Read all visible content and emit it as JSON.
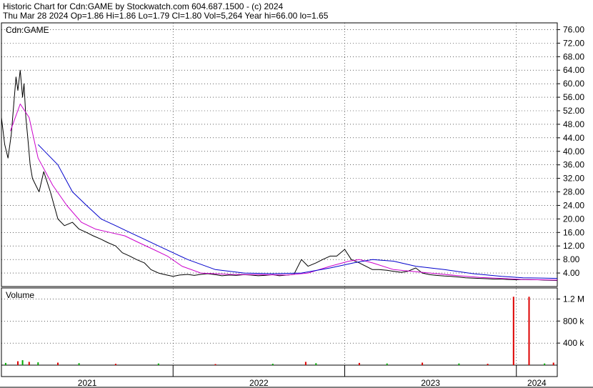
{
  "header": {
    "line1": "Historic Chart for Cdn:GAME by Stockwatch.com 604.687.1500 - (c) 2024",
    "line2": "Thu Mar 28 2024  Op=1.86  Hi=1.86  Lo=1.79  Cl=1.80  Vol=5,264  Year hi=66.00  lo=1.65"
  },
  "colors": {
    "price": "#000000",
    "ma_short": "#cc00cc",
    "ma_long": "#0000cc",
    "volume_up": "#00aa00",
    "volume_down": "#dd0000",
    "grid": "#000000"
  },
  "chart_data": [
    {
      "type": "line",
      "label": "Cdn:GAME",
      "ylim": [
        0,
        78
      ],
      "y_ticks": [
        "4.00",
        "8.00",
        "12.00",
        "16.00",
        "20.00",
        "24.00",
        "28.00",
        "32.00",
        "36.00",
        "40.00",
        "44.00",
        "48.00",
        "52.00",
        "56.00",
        "60.00",
        "64.00",
        "68.00",
        "72.00",
        "76.00"
      ],
      "x_ticks": [
        "2021",
        "2022",
        "2023",
        "2024"
      ],
      "x_range": [
        "2021-01-01",
        "2024-03-28"
      ],
      "grid": true,
      "series": [
        {
          "role": "price",
          "x": [
            "2021-01-01",
            "2021-01-08",
            "2021-01-15",
            "2021-01-22",
            "2021-02-01",
            "2021-02-05",
            "2021-02-10",
            "2021-02-15",
            "2021-02-18",
            "2021-02-22",
            "2021-02-26",
            "2021-03-03",
            "2021-03-08",
            "2021-03-15",
            "2021-03-22",
            "2021-04-01",
            "2021-04-15",
            "2021-05-01",
            "2021-05-15",
            "2021-06-01",
            "2021-06-15",
            "2021-07-01",
            "2021-07-15",
            "2021-08-01",
            "2021-08-15",
            "2021-09-01",
            "2021-09-15",
            "2021-10-01",
            "2021-10-15",
            "2021-11-01",
            "2021-11-15",
            "2021-12-01",
            "2021-12-15",
            "2022-01-01",
            "2022-01-15",
            "2022-02-01",
            "2022-02-15",
            "2022-03-01",
            "2022-03-15",
            "2022-04-01",
            "2022-04-15",
            "2022-05-01",
            "2022-05-15",
            "2022-06-01",
            "2022-06-15",
            "2022-07-01",
            "2022-07-15",
            "2022-08-01",
            "2022-08-15",
            "2022-09-01",
            "2022-09-15",
            "2022-10-01",
            "2022-10-15",
            "2022-11-01",
            "2022-11-15",
            "2022-12-01",
            "2022-12-15",
            "2023-01-01",
            "2023-01-15",
            "2023-02-01",
            "2023-02-15",
            "2023-03-01",
            "2023-03-15",
            "2023-04-01",
            "2023-04-15",
            "2023-05-01",
            "2023-05-15",
            "2023-06-01",
            "2023-06-15",
            "2023-07-01",
            "2023-07-15",
            "2023-08-01",
            "2023-08-15",
            "2023-09-01",
            "2023-09-15",
            "2023-10-01",
            "2023-10-15",
            "2023-11-01",
            "2023-11-15",
            "2023-12-01",
            "2023-12-15",
            "2024-01-01",
            "2024-01-15",
            "2024-02-01",
            "2024-02-15",
            "2024-03-01",
            "2024-03-15",
            "2024-03-28"
          ],
          "y": [
            50,
            42,
            38,
            45,
            62,
            58,
            64,
            56,
            60,
            50,
            44,
            36,
            32,
            30,
            28,
            34,
            28,
            20,
            18,
            19,
            17,
            16,
            15,
            14,
            13,
            12,
            10,
            9,
            8,
            7,
            5,
            4,
            3.5,
            3,
            3.4,
            3.6,
            3.3,
            3.6,
            3.8,
            3.5,
            3.2,
            3.4,
            3.3,
            3.5,
            3.4,
            3.2,
            3.3,
            3.5,
            3.2,
            3.4,
            3.6,
            8,
            6,
            7,
            8,
            9,
            9,
            11,
            8,
            7,
            6,
            5,
            5,
            4.8,
            4.5,
            4.2,
            4.5,
            5.5,
            4,
            3.5,
            3.3,
            3.1,
            3,
            2.8,
            2.6,
            2.5,
            2.4,
            2.3,
            2.2,
            2.2,
            2.1,
            2,
            2.1,
            2,
            2,
            1.9,
            1.85,
            1.8
          ]
        },
        {
          "role": "moving-average-short",
          "x": [
            "2021-01-20",
            "2021-02-10",
            "2021-03-01",
            "2021-03-20",
            "2021-04-20",
            "2021-05-20",
            "2021-06-20",
            "2021-07-20",
            "2021-08-20",
            "2021-09-20",
            "2021-10-20",
            "2021-11-20",
            "2021-12-20",
            "2022-01-20",
            "2022-03-01",
            "2022-05-01",
            "2022-07-01",
            "2022-09-01",
            "2022-10-15",
            "2022-12-01",
            "2023-01-10",
            "2023-02-01",
            "2023-03-01",
            "2023-04-15",
            "2023-06-01",
            "2023-07-15",
            "2023-09-01",
            "2023-10-15",
            "2023-12-01",
            "2024-01-15",
            "2024-03-28"
          ],
          "y": [
            46,
            54,
            50,
            38,
            30,
            24,
            19,
            17,
            16,
            15,
            13,
            11,
            9,
            6,
            4,
            3.6,
            3.5,
            3.4,
            4,
            6,
            7.5,
            8,
            7,
            5,
            4.4,
            3.8,
            3.2,
            2.7,
            2.4,
            2.1,
            1.9
          ]
        },
        {
          "role": "moving-average-long",
          "x": [
            "2021-03-20",
            "2021-05-01",
            "2021-06-01",
            "2021-07-01",
            "2021-08-01",
            "2021-09-01",
            "2021-10-01",
            "2021-11-01",
            "2021-12-01",
            "2022-01-01",
            "2022-02-01",
            "2022-04-01",
            "2022-06-01",
            "2022-08-01",
            "2022-10-01",
            "2022-12-01",
            "2023-01-20",
            "2023-03-01",
            "2023-04-15",
            "2023-06-01",
            "2023-08-01",
            "2023-10-01",
            "2023-12-01",
            "2024-01-15",
            "2024-03-28"
          ],
          "y": [
            42,
            36,
            28,
            24,
            20,
            18,
            16,
            14,
            12,
            10,
            8,
            5,
            4,
            3.8,
            4,
            5.5,
            7,
            8,
            7.5,
            6,
            5,
            3.8,
            3,
            2.6,
            2.4
          ]
        }
      ]
    },
    {
      "type": "bar",
      "label": "Volume",
      "ylim": [
        0,
        1400000
      ],
      "y_ticks": [
        "400 k",
        "800 k",
        "1.2 M"
      ],
      "series": [
        {
          "role": "volume",
          "x": [
            "2021-01-10",
            "2021-02-05",
            "2021-02-15",
            "2021-03-01",
            "2021-03-20",
            "2021-05-01",
            "2021-06-15",
            "2021-09-01",
            "2021-12-01",
            "2022-04-01",
            "2022-08-01",
            "2022-10-10",
            "2022-11-01",
            "2023-02-01",
            "2023-04-01",
            "2023-06-15",
            "2023-09-01",
            "2023-11-01",
            "2023-12-26",
            "2024-01-28",
            "2024-03-01",
            "2024-03-20"
          ],
          "y": [
            40000,
            70000,
            90000,
            60000,
            50000,
            45000,
            35000,
            25000,
            30000,
            20000,
            25000,
            60000,
            35000,
            40000,
            30000,
            45000,
            30000,
            25000,
            1240000,
            1240000,
            30000,
            45000
          ]
        }
      ]
    }
  ]
}
